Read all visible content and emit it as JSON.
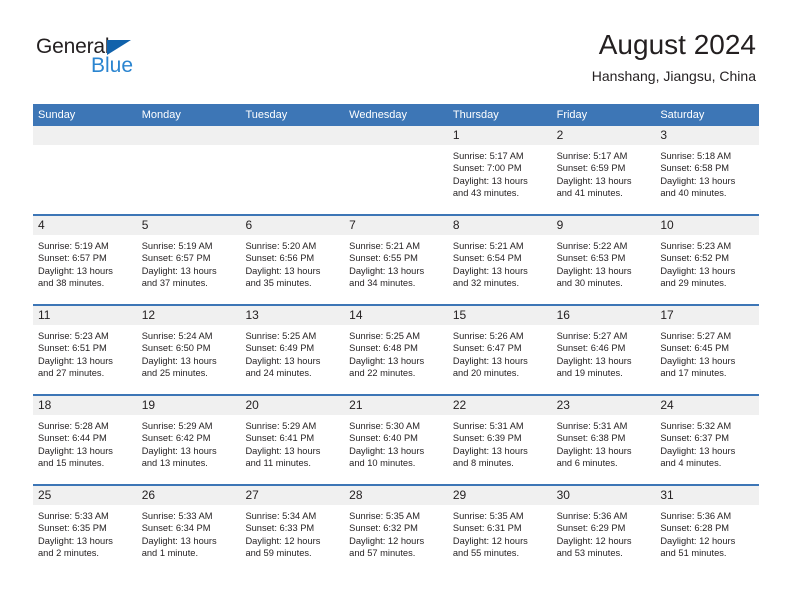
{
  "brand": {
    "name_part1": "General",
    "name_part2": "Blue",
    "triangle_color": "#1162ab",
    "blue_color": "#2b85d0"
  },
  "header": {
    "title": "August 2024",
    "location": "Hanshang, Jiangsu, China"
  },
  "theme": {
    "header_blue": "#3d76b6",
    "daynum_band": "#f0f0f0",
    "text": "#231f20"
  },
  "weekday_headers": [
    "Sunday",
    "Monday",
    "Tuesday",
    "Wednesday",
    "Thursday",
    "Friday",
    "Saturday"
  ],
  "weeks": [
    [
      {
        "day": "",
        "l1": "",
        "l2": "",
        "l3": "",
        "l4": ""
      },
      {
        "day": "",
        "l1": "",
        "l2": "",
        "l3": "",
        "l4": ""
      },
      {
        "day": "",
        "l1": "",
        "l2": "",
        "l3": "",
        "l4": ""
      },
      {
        "day": "",
        "l1": "",
        "l2": "",
        "l3": "",
        "l4": ""
      },
      {
        "day": "1",
        "l1": "Sunrise: 5:17 AM",
        "l2": "Sunset: 7:00 PM",
        "l3": "Daylight: 13 hours",
        "l4": "and 43 minutes."
      },
      {
        "day": "2",
        "l1": "Sunrise: 5:17 AM",
        "l2": "Sunset: 6:59 PM",
        "l3": "Daylight: 13 hours",
        "l4": "and 41 minutes."
      },
      {
        "day": "3",
        "l1": "Sunrise: 5:18 AM",
        "l2": "Sunset: 6:58 PM",
        "l3": "Daylight: 13 hours",
        "l4": "and 40 minutes."
      }
    ],
    [
      {
        "day": "4",
        "l1": "Sunrise: 5:19 AM",
        "l2": "Sunset: 6:57 PM",
        "l3": "Daylight: 13 hours",
        "l4": "and 38 minutes."
      },
      {
        "day": "5",
        "l1": "Sunrise: 5:19 AM",
        "l2": "Sunset: 6:57 PM",
        "l3": "Daylight: 13 hours",
        "l4": "and 37 minutes."
      },
      {
        "day": "6",
        "l1": "Sunrise: 5:20 AM",
        "l2": "Sunset: 6:56 PM",
        "l3": "Daylight: 13 hours",
        "l4": "and 35 minutes."
      },
      {
        "day": "7",
        "l1": "Sunrise: 5:21 AM",
        "l2": "Sunset: 6:55 PM",
        "l3": "Daylight: 13 hours",
        "l4": "and 34 minutes."
      },
      {
        "day": "8",
        "l1": "Sunrise: 5:21 AM",
        "l2": "Sunset: 6:54 PM",
        "l3": "Daylight: 13 hours",
        "l4": "and 32 minutes."
      },
      {
        "day": "9",
        "l1": "Sunrise: 5:22 AM",
        "l2": "Sunset: 6:53 PM",
        "l3": "Daylight: 13 hours",
        "l4": "and 30 minutes."
      },
      {
        "day": "10",
        "l1": "Sunrise: 5:23 AM",
        "l2": "Sunset: 6:52 PM",
        "l3": "Daylight: 13 hours",
        "l4": "and 29 minutes."
      }
    ],
    [
      {
        "day": "11",
        "l1": "Sunrise: 5:23 AM",
        "l2": "Sunset: 6:51 PM",
        "l3": "Daylight: 13 hours",
        "l4": "and 27 minutes."
      },
      {
        "day": "12",
        "l1": "Sunrise: 5:24 AM",
        "l2": "Sunset: 6:50 PM",
        "l3": "Daylight: 13 hours",
        "l4": "and 25 minutes."
      },
      {
        "day": "13",
        "l1": "Sunrise: 5:25 AM",
        "l2": "Sunset: 6:49 PM",
        "l3": "Daylight: 13 hours",
        "l4": "and 24 minutes."
      },
      {
        "day": "14",
        "l1": "Sunrise: 5:25 AM",
        "l2": "Sunset: 6:48 PM",
        "l3": "Daylight: 13 hours",
        "l4": "and 22 minutes."
      },
      {
        "day": "15",
        "l1": "Sunrise: 5:26 AM",
        "l2": "Sunset: 6:47 PM",
        "l3": "Daylight: 13 hours",
        "l4": "and 20 minutes."
      },
      {
        "day": "16",
        "l1": "Sunrise: 5:27 AM",
        "l2": "Sunset: 6:46 PM",
        "l3": "Daylight: 13 hours",
        "l4": "and 19 minutes."
      },
      {
        "day": "17",
        "l1": "Sunrise: 5:27 AM",
        "l2": "Sunset: 6:45 PM",
        "l3": "Daylight: 13 hours",
        "l4": "and 17 minutes."
      }
    ],
    [
      {
        "day": "18",
        "l1": "Sunrise: 5:28 AM",
        "l2": "Sunset: 6:44 PM",
        "l3": "Daylight: 13 hours",
        "l4": "and 15 minutes."
      },
      {
        "day": "19",
        "l1": "Sunrise: 5:29 AM",
        "l2": "Sunset: 6:42 PM",
        "l3": "Daylight: 13 hours",
        "l4": "and 13 minutes."
      },
      {
        "day": "20",
        "l1": "Sunrise: 5:29 AM",
        "l2": "Sunset: 6:41 PM",
        "l3": "Daylight: 13 hours",
        "l4": "and 11 minutes."
      },
      {
        "day": "21",
        "l1": "Sunrise: 5:30 AM",
        "l2": "Sunset: 6:40 PM",
        "l3": "Daylight: 13 hours",
        "l4": "and 10 minutes."
      },
      {
        "day": "22",
        "l1": "Sunrise: 5:31 AM",
        "l2": "Sunset: 6:39 PM",
        "l3": "Daylight: 13 hours",
        "l4": "and 8 minutes."
      },
      {
        "day": "23",
        "l1": "Sunrise: 5:31 AM",
        "l2": "Sunset: 6:38 PM",
        "l3": "Daylight: 13 hours",
        "l4": "and 6 minutes."
      },
      {
        "day": "24",
        "l1": "Sunrise: 5:32 AM",
        "l2": "Sunset: 6:37 PM",
        "l3": "Daylight: 13 hours",
        "l4": "and 4 minutes."
      }
    ],
    [
      {
        "day": "25",
        "l1": "Sunrise: 5:33 AM",
        "l2": "Sunset: 6:35 PM",
        "l3": "Daylight: 13 hours",
        "l4": "and 2 minutes."
      },
      {
        "day": "26",
        "l1": "Sunrise: 5:33 AM",
        "l2": "Sunset: 6:34 PM",
        "l3": "Daylight: 13 hours",
        "l4": "and 1 minute."
      },
      {
        "day": "27",
        "l1": "Sunrise: 5:34 AM",
        "l2": "Sunset: 6:33 PM",
        "l3": "Daylight: 12 hours",
        "l4": "and 59 minutes."
      },
      {
        "day": "28",
        "l1": "Sunrise: 5:35 AM",
        "l2": "Sunset: 6:32 PM",
        "l3": "Daylight: 12 hours",
        "l4": "and 57 minutes."
      },
      {
        "day": "29",
        "l1": "Sunrise: 5:35 AM",
        "l2": "Sunset: 6:31 PM",
        "l3": "Daylight: 12 hours",
        "l4": "and 55 minutes."
      },
      {
        "day": "30",
        "l1": "Sunrise: 5:36 AM",
        "l2": "Sunset: 6:29 PM",
        "l3": "Daylight: 12 hours",
        "l4": "and 53 minutes."
      },
      {
        "day": "31",
        "l1": "Sunrise: 5:36 AM",
        "l2": "Sunset: 6:28 PM",
        "l3": "Daylight: 12 hours",
        "l4": "and 51 minutes."
      }
    ]
  ]
}
